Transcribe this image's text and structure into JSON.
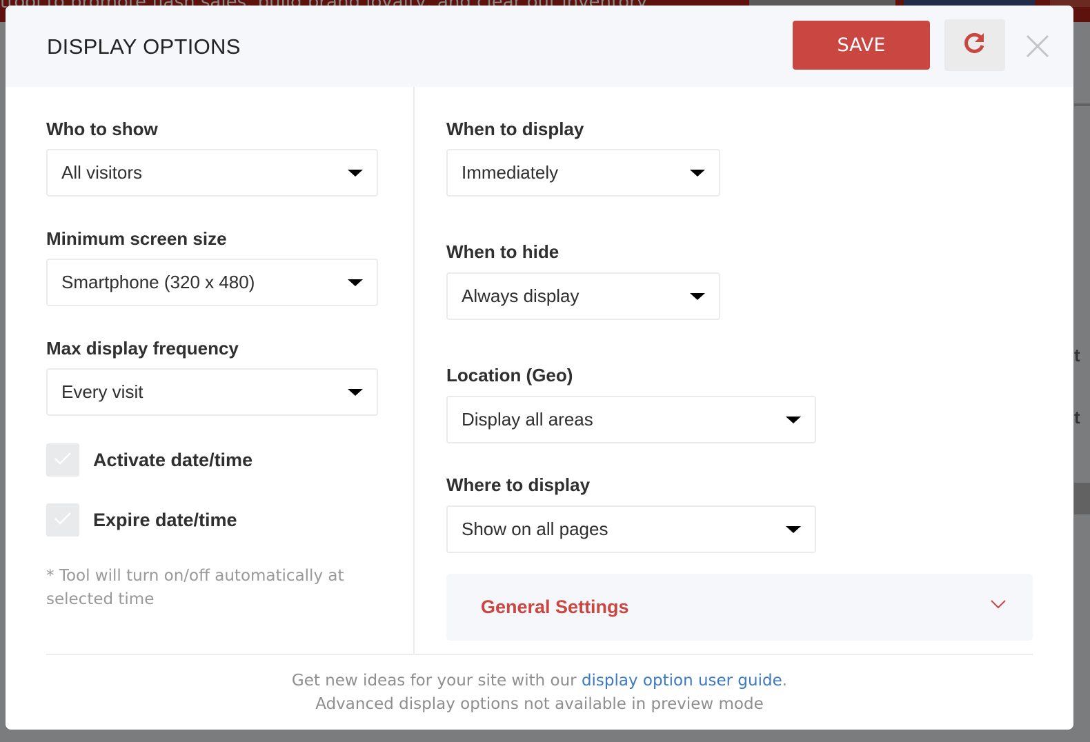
{
  "background": {
    "tagline_fragment": "ttool to promote flash sales, build brand loyalty, and clear out inventory",
    "side_letters": [
      "t",
      "t"
    ]
  },
  "modal": {
    "title": "DISPLAY OPTIONS",
    "save_label": "SAVE",
    "reset_icon": "refresh-icon",
    "close_icon": "close-icon"
  },
  "left_column": {
    "fields": [
      {
        "label": "Who to show",
        "value": "All visitors"
      },
      {
        "label": "Minimum screen size",
        "value": "Smartphone (320 x 480)"
      },
      {
        "label": "Max display frequency",
        "value": "Every visit"
      }
    ],
    "checkboxes": [
      {
        "label": "Activate date/time",
        "checked": false
      },
      {
        "label": "Expire date/time",
        "checked": false
      }
    ],
    "note": "* Tool will turn on/off automatically at selected time"
  },
  "right_column": {
    "fields": [
      {
        "label": "When to display",
        "value": "Immediately"
      },
      {
        "label": "When to hide",
        "value": "Always display"
      },
      {
        "label": "Location (Geo)",
        "value": "Display all areas"
      },
      {
        "label": "Where to display",
        "value": "Show on all pages"
      }
    ],
    "general_settings": {
      "label": "General Settings",
      "expanded": false
    }
  },
  "footer": {
    "line1_prefix": "Get new ideas for your site with our ",
    "link_text": "display option user guide",
    "line1_suffix": ".",
    "line2": "Advanced display options not available in preview mode"
  },
  "colors": {
    "accent_red": "#c94641",
    "link_blue": "#3d7ac2",
    "header_bg": "#f6f7fb"
  }
}
